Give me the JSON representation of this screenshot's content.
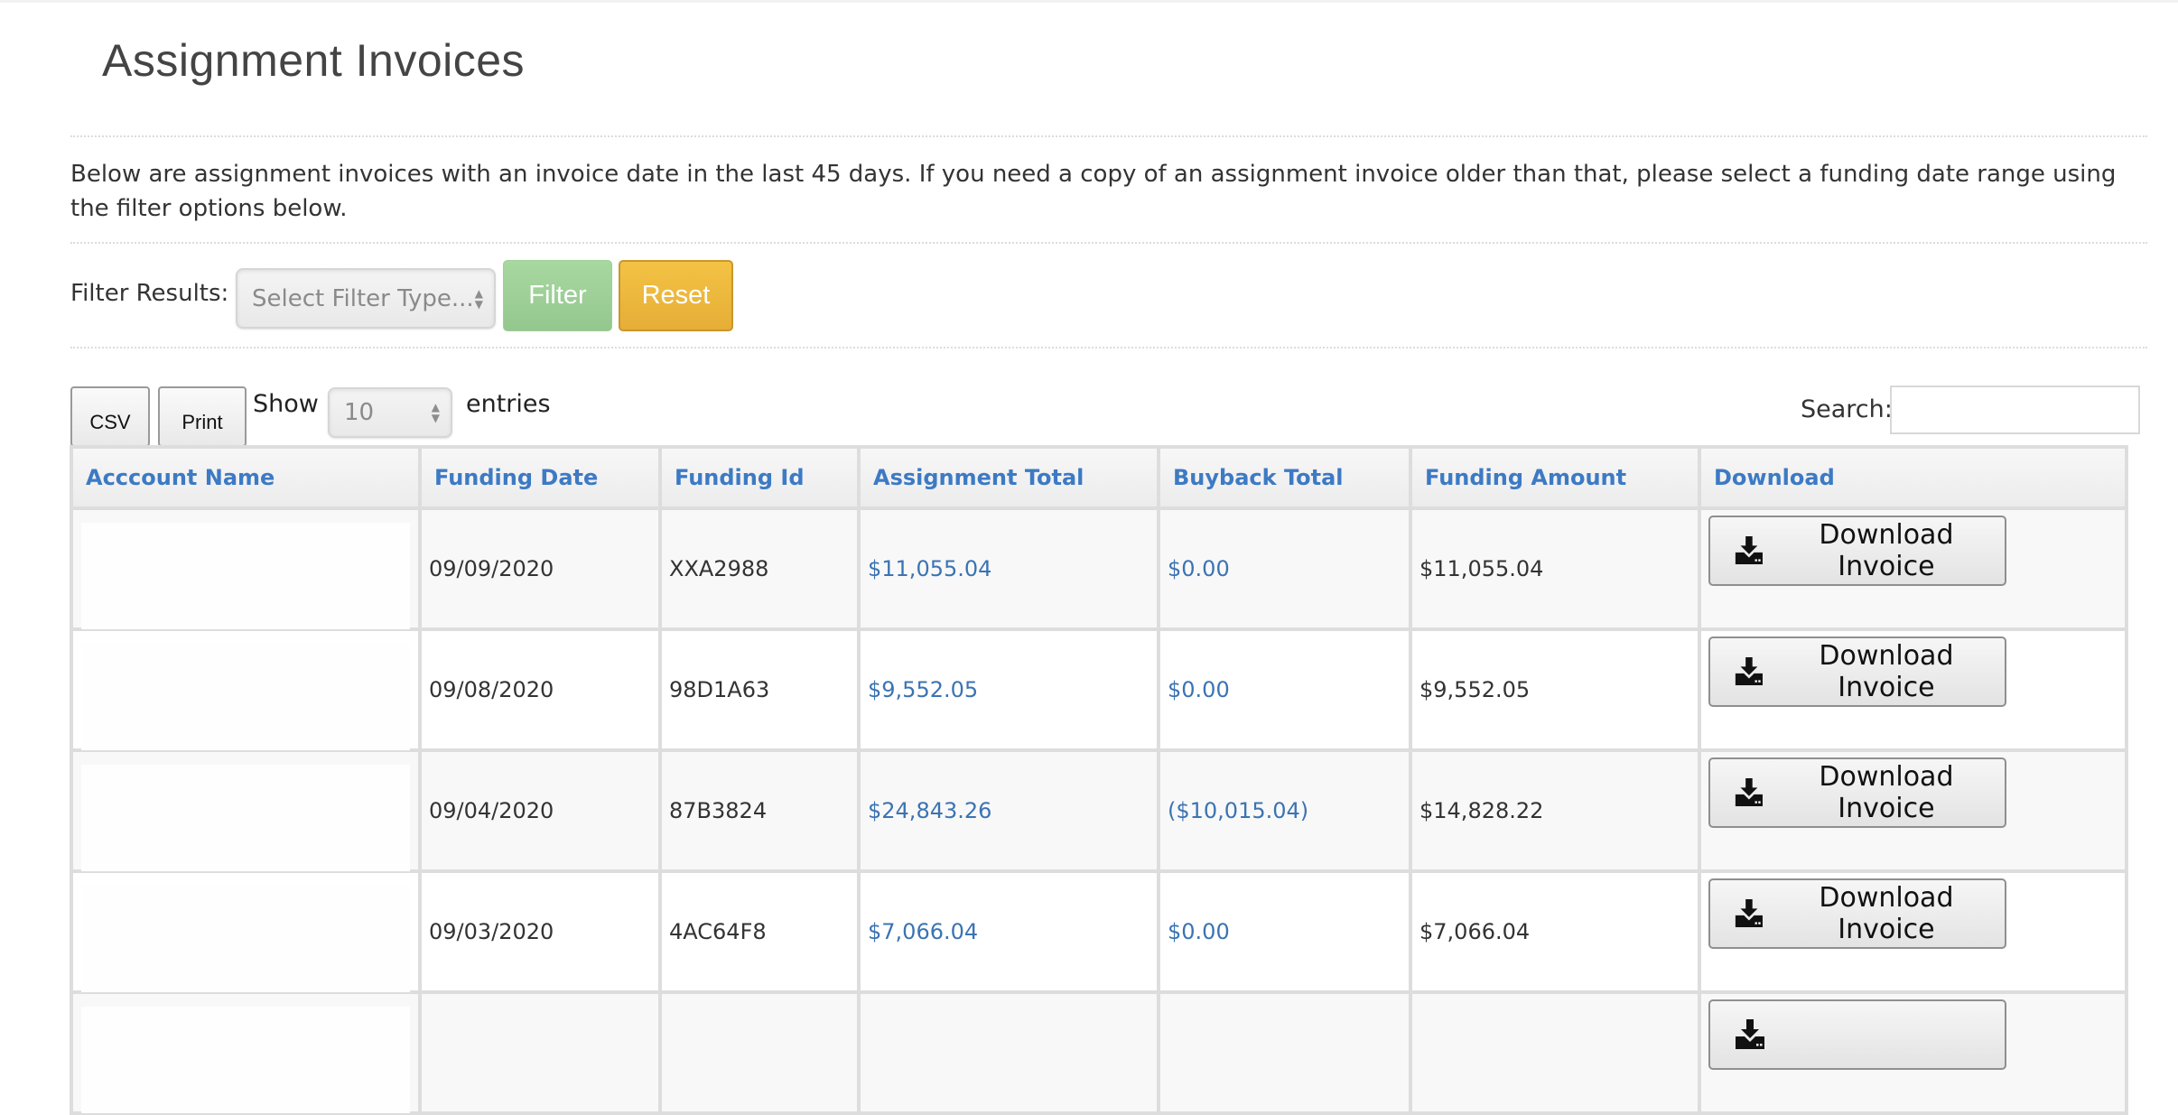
{
  "page": {
    "title": "Assignment Invoices",
    "intro": "Below are assignment invoices with an invoice date in the last 45 days. If you need a copy of an assignment invoice older than that, please select a funding date range using the filter options below."
  },
  "filter": {
    "label": "Filter Results:",
    "select_placeholder": "Select Filter Type...",
    "filter_button": "Filter",
    "reset_button": "Reset",
    "colors": {
      "filter": "#9ccf96",
      "reset": "#ecb83d"
    }
  },
  "table_controls": {
    "csv_button": "CSV",
    "print_button": "Print",
    "show_label": "Show",
    "page_size": "10",
    "entries_label": "entries",
    "search_label": "Search:",
    "search_value": ""
  },
  "table": {
    "columns": [
      "Acccount Name",
      "Funding Date",
      "Funding Id",
      "Assignment Total",
      "Buyback Total",
      "Funding Amount",
      "Download"
    ],
    "header_color": "#3d7ac4",
    "rows": [
      {
        "account_name": "",
        "funding_date": "09/09/2020",
        "funding_id": "XXA2988",
        "assignment_total": "$11,055.04",
        "buyback_total": "$0.00",
        "funding_amount": "$11,055.04",
        "download_label": "Download Invoice"
      },
      {
        "account_name": "",
        "funding_date": "09/08/2020",
        "funding_id": "98D1A63",
        "assignment_total": "$9,552.05",
        "buyback_total": "$0.00",
        "funding_amount": "$9,552.05",
        "download_label": "Download Invoice"
      },
      {
        "account_name": "",
        "funding_date": "09/04/2020",
        "funding_id": "87B3824",
        "assignment_total": "$24,843.26",
        "buyback_total": "($10,015.04)",
        "funding_amount": "$14,828.22",
        "download_label": "Download Invoice"
      },
      {
        "account_name": "",
        "funding_date": "09/03/2020",
        "funding_id": "4AC64F8",
        "assignment_total": "$7,066.04",
        "buyback_total": "$0.00",
        "funding_amount": "$7,066.04",
        "download_label": "Download Invoice"
      },
      {
        "account_name": "",
        "funding_date": "",
        "funding_id": "",
        "assignment_total": "",
        "buyback_total": "",
        "funding_amount": "",
        "download_label": ""
      }
    ]
  },
  "icons": {
    "download": "download-icon"
  }
}
